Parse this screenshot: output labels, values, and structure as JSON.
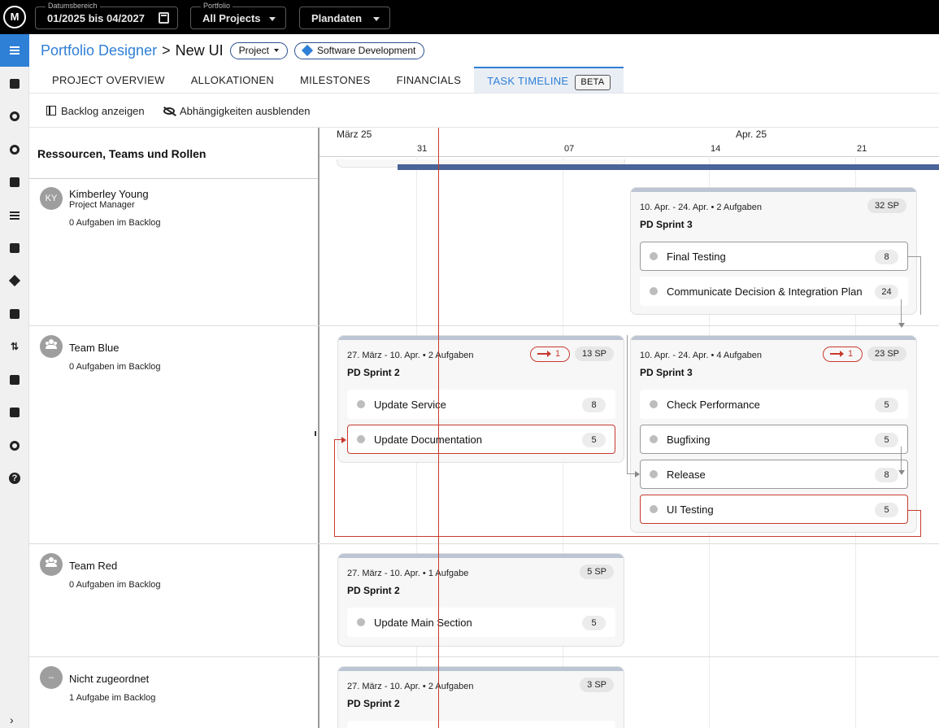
{
  "topbar": {
    "date_caption": "Datumsbereich",
    "date_value": "01/2025 bis 04/2027",
    "portfolio_caption": "Portfolio",
    "portfolio_value": "All Projects",
    "mode_value": "Plandaten"
  },
  "breadcrumb": {
    "root": "Portfolio Designer",
    "separator": ">",
    "current": "New UI",
    "type_chip": "Project",
    "category_chip": "Software Development"
  },
  "tabs": [
    {
      "label": "PROJECT OVERVIEW"
    },
    {
      "label": "ALLOKATIONEN"
    },
    {
      "label": "MILESTONES"
    },
    {
      "label": "FINANCIALS"
    },
    {
      "label": "TASK TIMELINE",
      "badge": "BETA",
      "active": true
    }
  ],
  "toolbar": {
    "backlog_label": "Backlog anzeigen",
    "dependencies_label": "Abhängigkeiten ausblenden"
  },
  "timeline": {
    "resources_title": "Ressourcen, Teams und Rollen",
    "months": [
      "März 25",
      "Apr. 25"
    ],
    "days": [
      "31",
      "07",
      "14",
      "21"
    ]
  },
  "resources": [
    {
      "initials": "KY",
      "name": "Kimberley Young",
      "role": "Project Manager",
      "backlog": "0 Aufgaben im Backlog",
      "icon": "person-avatar"
    },
    {
      "name": "Team Blue",
      "backlog": "0 Aufgaben im Backlog",
      "icon": "group-icon"
    },
    {
      "name": "Team Red",
      "backlog": "0 Aufgaben im Backlog",
      "icon": "group-icon"
    },
    {
      "initials": "–",
      "name": "Nicht zugeordnet",
      "backlog": "1 Aufgabe im Backlog",
      "icon": "unassigned-avatar"
    }
  ],
  "sprints": [
    {
      "meta": "10. Apr. - 24. Apr. • 2 Aufgaben",
      "title": "PD Sprint 3",
      "sp": "32 SP",
      "tasks": [
        {
          "name": "Final Testing",
          "sp": "8"
        },
        {
          "name": "Communicate Decision & Integration Plan",
          "sp": "24"
        }
      ]
    },
    {
      "meta": "27. März - 10. Apr. • 2 Aufgaben",
      "title": "PD Sprint 2",
      "sp": "13 SP",
      "dependencies": "1",
      "tasks": [
        {
          "name": "Update Service",
          "sp": "8"
        },
        {
          "name": "Update Documentation",
          "sp": "5"
        }
      ]
    },
    {
      "meta": "10. Apr. - 24. Apr. • 4 Aufgaben",
      "title": "PD Sprint 3",
      "sp": "23 SP",
      "dependencies": "1",
      "tasks": [
        {
          "name": "Check Performance",
          "sp": "5"
        },
        {
          "name": "Bugfixing",
          "sp": "5"
        },
        {
          "name": "Release",
          "sp": "8"
        },
        {
          "name": "UI Testing",
          "sp": "5"
        }
      ]
    },
    {
      "meta": "27. März - 10. Apr. • 1 Aufgabe",
      "title": "PD Sprint 2",
      "sp": "5 SP",
      "tasks": [
        {
          "name": "Update Main Section",
          "sp": "5"
        }
      ]
    },
    {
      "meta": "27. März - 10. Apr. • 2 Aufgaben",
      "title": "PD Sprint 2",
      "sp": "3 SP"
    }
  ],
  "colors": {
    "accent": "#2e7fd6",
    "today_line": "#c83a2e",
    "progress_bar": "#4a6398",
    "sprint_header": "#bcc5d3"
  }
}
